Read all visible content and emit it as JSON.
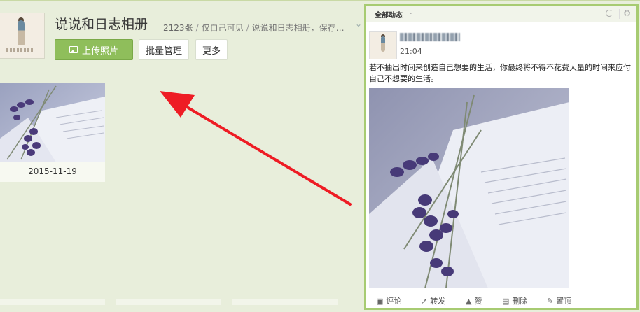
{
  "album": {
    "title": "说说和日志相册",
    "count": "2123张",
    "privacy": "仅自己可见",
    "description": "说说和日志相册，保存…"
  },
  "toolbar": {
    "upload_label": "上传照片",
    "batch_label": "批量管理",
    "more_label": "更多"
  },
  "photos": [
    {
      "date": "2015-11-19"
    }
  ],
  "feed": {
    "tab_label": "全部动态",
    "post": {
      "time": "21:04",
      "text": "若不抽出时间来创造自己想要的生活，你最终将不得不花费大量的时间来应付自己不想要的生活。"
    },
    "actions": {
      "comment": "评论",
      "forward": "转发",
      "like": "赞",
      "delete": "删除",
      "pin": "置顶"
    }
  },
  "colors": {
    "background": "#e8eedb",
    "accent_green": "#8fbe5b",
    "panel_border": "#a7cb72",
    "arrow_red": "#ee1c24"
  }
}
